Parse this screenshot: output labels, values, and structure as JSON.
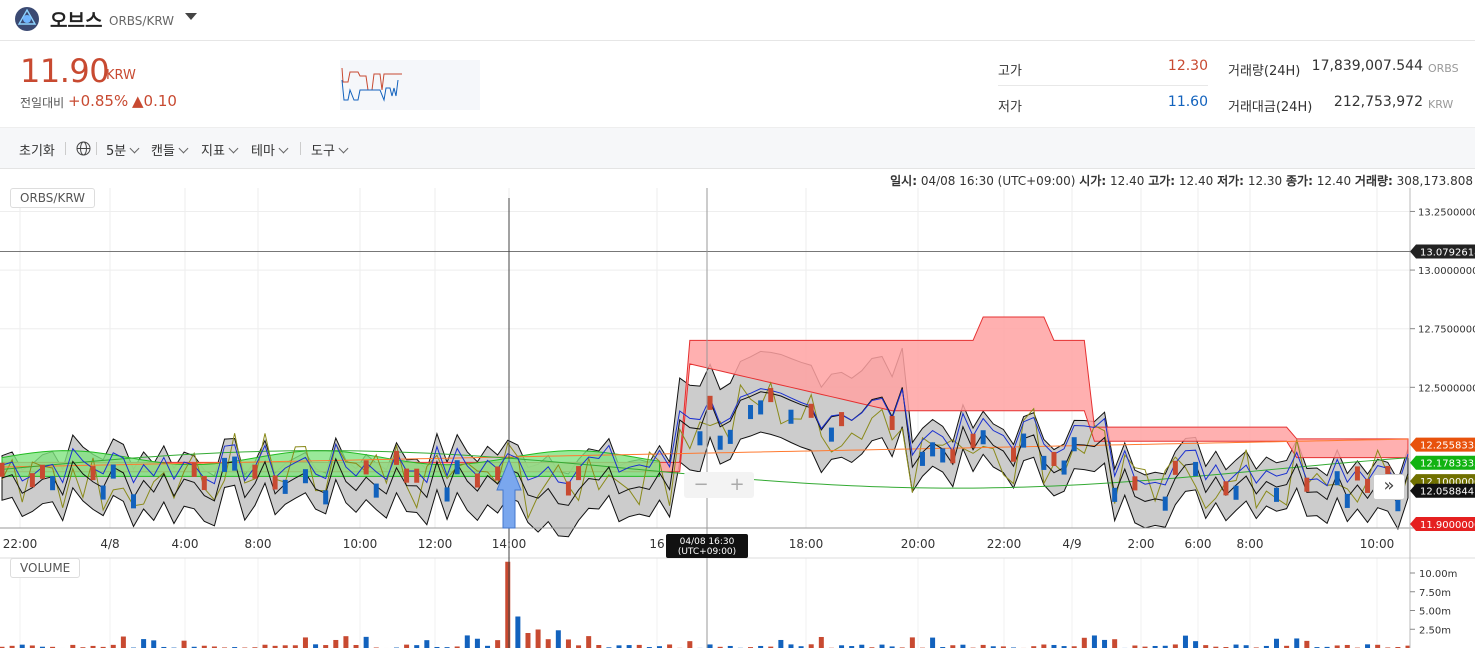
{
  "header": {
    "coin_name": "오브스",
    "pair": "ORBS/KRW"
  },
  "price": {
    "current": "11.90",
    "unit": "KRW",
    "change_label": "전일대비",
    "change_pct": "+0.85%",
    "change_abs": "▲0.10"
  },
  "stats": {
    "high_label": "고가",
    "high": "12.30",
    "low_label": "저가",
    "low": "11.60",
    "vol_label": "거래량(24H)",
    "vol": "17,839,007.544",
    "vol_unit": "ORBS",
    "amt_label": "거래대금(24H)",
    "amt": "212,753,972",
    "amt_unit": "KRW"
  },
  "toolbar": {
    "reset": "초기화",
    "interval": "5분",
    "candle": "캔들",
    "indicator": "지표",
    "theme": "테마",
    "tools": "도구"
  },
  "info_bar": {
    "time_label": "일시:",
    "time": "04/08 16:30 (UTC+09:00)",
    "open_label": "시가:",
    "open": "12.40",
    "high_label": "고가:",
    "high": "12.40",
    "low_label": "저가:",
    "low": "12.30",
    "close_label": "종가:",
    "close": "12.40",
    "vol_label": "거래량:",
    "vol": "308,173.808"
  },
  "panes": {
    "price": "ORBS/KRW",
    "volume": "VOLUME"
  },
  "colors": {
    "up": "#c84a31",
    "down": "#1262bd",
    "cloud_bear": "#ffa2a2",
    "cloud_bull": "#7fe37f",
    "band": "#c6c6c6"
  },
  "chart_data": {
    "type": "line",
    "x_ticks": [
      "22:00",
      "4/8",
      "4:00",
      "8:00",
      "10:00",
      "12:00",
      "14:00",
      "16",
      "18:00",
      "20:00",
      "22:00",
      "4/9",
      "2:00",
      "6:00",
      "8:00",
      "10:00"
    ],
    "y_ticks": [
      "13.25000000",
      "13.00000000",
      "12.75000000",
      "12.50000000"
    ],
    "ylim": [
      11.9,
      13.35
    ],
    "price_labels": [
      {
        "value": 13.07926186,
        "text": "13.07926186",
        "color": "#222222"
      },
      {
        "value": 12.2558,
        "text": "12.25583333",
        "color": "#e8520c"
      },
      {
        "value": 12.1783,
        "text": "12.17833333",
        "color": "#12b312"
      },
      {
        "value": 12.1,
        "text": "12.10000000",
        "color": "#707000"
      },
      {
        "value": 12.0589,
        "text": "12.05884477",
        "color": "#111111"
      },
      {
        "value": 11.9,
        "text": "11.90000000",
        "color": "#e52020"
      }
    ],
    "crosshair": {
      "time_label": "04/08 16:30",
      "time_label2": "(UTC+09:00)",
      "price": 13.07926186
    },
    "volume_ticks": [
      "10.00m",
      "7.50m",
      "5.00m",
      "2.50m"
    ],
    "volume_max": 12.0
  }
}
